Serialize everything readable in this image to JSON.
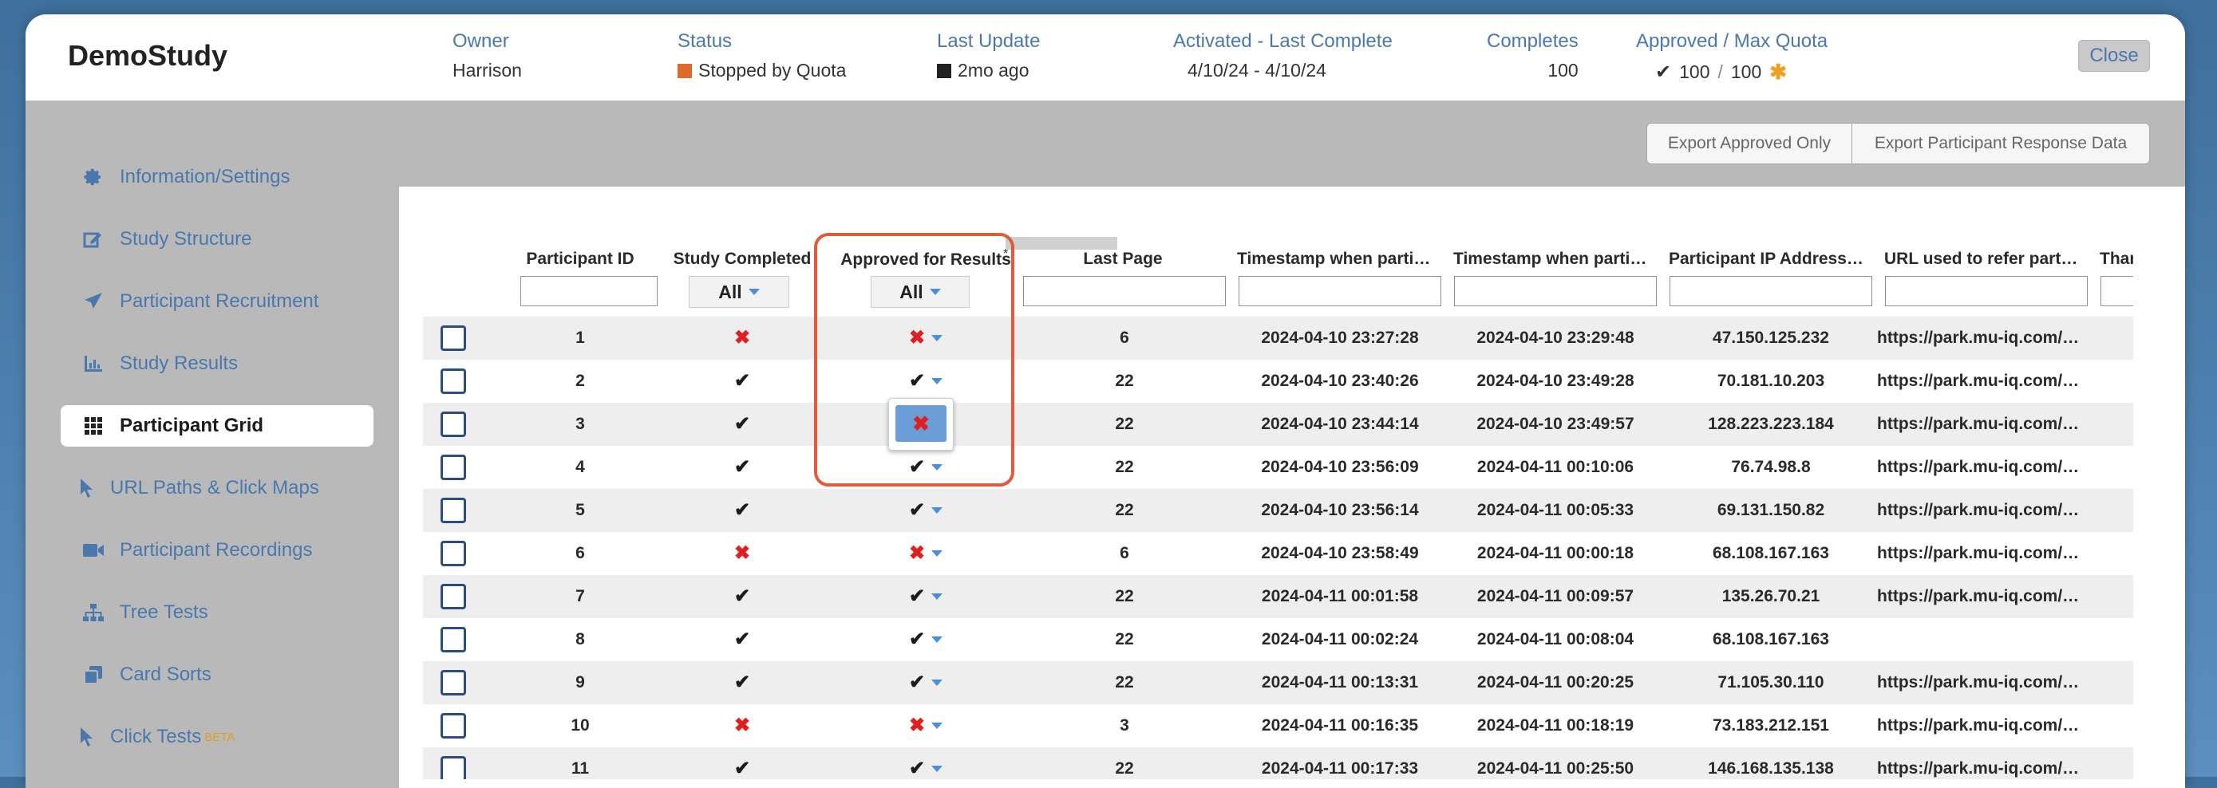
{
  "study": {
    "title": "DemoStudy"
  },
  "header": {
    "owner": {
      "label": "Owner",
      "value": "Harrison"
    },
    "status": {
      "label": "Status",
      "value": "Stopped by Quota",
      "color": "#e06a2c"
    },
    "last_update": {
      "label": "Last Update",
      "value": "2mo ago"
    },
    "activated": {
      "label": "Activated - Last Complete",
      "value": "4/10/24 - 4/10/24"
    },
    "completes": {
      "label": "Completes",
      "value": "100"
    },
    "approved": {
      "label": "Approved / Max Quota",
      "approved": "100",
      "sep": "/",
      "max": "100"
    },
    "close_label": "Close"
  },
  "toolbar": {
    "export_approved": "Export Approved Only",
    "export_responses": "Export Participant Response Data"
  },
  "sidebar": {
    "items": [
      {
        "label": "Information/Settings",
        "icon": "gear-icon"
      },
      {
        "label": "Study Structure",
        "icon": "edit-icon"
      },
      {
        "label": "Participant Recruitment",
        "icon": "send-icon"
      },
      {
        "label": "Study Results",
        "icon": "bar-chart-icon"
      },
      {
        "label": "Participant Grid",
        "icon": "grid-icon",
        "active": true
      },
      {
        "label": "URL Paths & Click Maps",
        "icon": "cursor-icon"
      },
      {
        "label": "Participant Recordings",
        "icon": "video-icon"
      },
      {
        "label": "Tree Tests",
        "icon": "tree-icon"
      },
      {
        "label": "Card Sorts",
        "icon": "cards-icon"
      },
      {
        "label": "Click Tests",
        "icon": "cursor-icon",
        "badge": "BETA"
      }
    ]
  },
  "grid": {
    "columns": [
      "Participant ID",
      "Study Completed",
      "Approved for Results",
      "Last Page",
      "Timestamp when parti…",
      "Timestamp when parti…",
      "Participant IP Address…",
      "URL used to refer part…",
      "Thar"
    ],
    "filter_all": "All",
    "approved_asterisk": "*",
    "rows": [
      {
        "id": "1",
        "completed": false,
        "approved": false,
        "last_page": "6",
        "ts_start": "2024-04-10 23:27:28",
        "ts_end": "2024-04-10 23:29:48",
        "ip": "47.150.125.232",
        "url": "https://park.mu-iq.com/…"
      },
      {
        "id": "2",
        "completed": true,
        "approved": true,
        "last_page": "22",
        "ts_start": "2024-04-10 23:40:26",
        "ts_end": "2024-04-10 23:49:28",
        "ip": "70.181.10.203",
        "url": "https://park.mu-iq.com/…"
      },
      {
        "id": "3",
        "completed": true,
        "approved": null,
        "last_page": "22",
        "ts_start": "2024-04-10 23:44:14",
        "ts_end": "2024-04-10 23:49:57",
        "ip": "128.223.223.184",
        "url": "https://park.mu-iq.com/…"
      },
      {
        "id": "4",
        "completed": true,
        "approved": true,
        "last_page": "22",
        "ts_start": "2024-04-10 23:56:09",
        "ts_end": "2024-04-11 00:10:06",
        "ip": "76.74.98.8",
        "url": "https://park.mu-iq.com/…"
      },
      {
        "id": "5",
        "completed": true,
        "approved": true,
        "last_page": "22",
        "ts_start": "2024-04-10 23:56:14",
        "ts_end": "2024-04-11 00:05:33",
        "ip": "69.131.150.82",
        "url": "https://park.mu-iq.com/…"
      },
      {
        "id": "6",
        "completed": false,
        "approved": false,
        "last_page": "6",
        "ts_start": "2024-04-10 23:58:49",
        "ts_end": "2024-04-11 00:00:18",
        "ip": "68.108.167.163",
        "url": "https://park.mu-iq.com/…"
      },
      {
        "id": "7",
        "completed": true,
        "approved": true,
        "last_page": "22",
        "ts_start": "2024-04-11 00:01:58",
        "ts_end": "2024-04-11 00:09:57",
        "ip": "135.26.70.21",
        "url": "https://park.mu-iq.com/…"
      },
      {
        "id": "8",
        "completed": true,
        "approved": true,
        "last_page": "22",
        "ts_start": "2024-04-11 00:02:24",
        "ts_end": "2024-04-11 00:08:04",
        "ip": "68.108.167.163",
        "url": ""
      },
      {
        "id": "9",
        "completed": true,
        "approved": true,
        "last_page": "22",
        "ts_start": "2024-04-11 00:13:31",
        "ts_end": "2024-04-11 00:20:25",
        "ip": "71.105.30.110",
        "url": "https://park.mu-iq.com/…"
      },
      {
        "id": "10",
        "completed": false,
        "approved": false,
        "last_page": "3",
        "ts_start": "2024-04-11 00:16:35",
        "ts_end": "2024-04-11 00:18:19",
        "ip": "73.183.212.151",
        "url": "https://park.mu-iq.com/…"
      },
      {
        "id": "11",
        "completed": true,
        "approved": true,
        "last_page": "22",
        "ts_start": "2024-04-11 00:17:33",
        "ts_end": "2024-04-11 00:25:50",
        "ip": "146.168.135.138",
        "url": "https://park.mu-iq.com/…"
      }
    ]
  },
  "colors": {
    "accent": "#4a78ad",
    "reject": "#e02020",
    "highlight": "#e05a3c",
    "status_stopped": "#e06a2c",
    "quota_star": "#f0a020"
  }
}
